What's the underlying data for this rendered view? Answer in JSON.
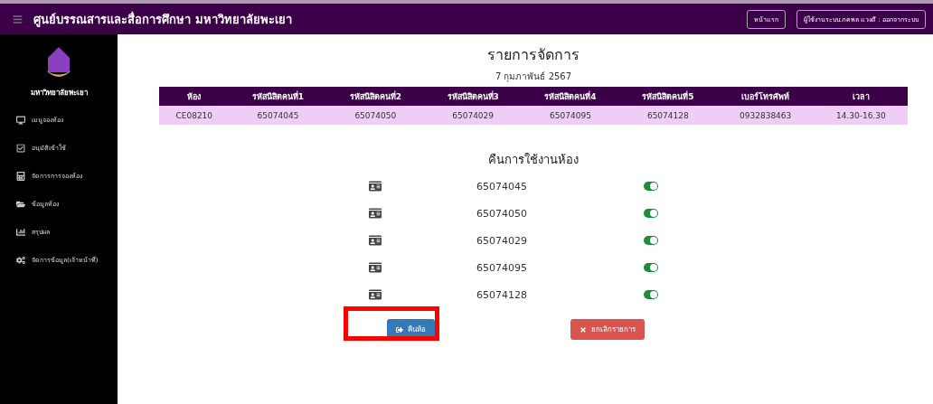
{
  "navbar": {
    "title": "ศูนย์บรรณสารและสื่อการศึกษา มหาวิทยาลัยพะเยา",
    "buttons": [
      "หน้าแรก",
      "ผู้ใช้งานระบบ:ภคพล แวงดี : ออกจากระบบ"
    ]
  },
  "sidebar": {
    "brand": "มหาวิทยาลัยพะเยา",
    "items": [
      {
        "label": "เมนูจองห้อง",
        "kind": "monitor"
      },
      {
        "label": "อนุมัติเข้าใช้",
        "kind": "check"
      },
      {
        "label": "จัดการการจองห้อง",
        "kind": "calc"
      },
      {
        "label": "ข้อมูลห้อง",
        "kind": "folder"
      },
      {
        "label": "สรุปผล",
        "kind": "chart"
      },
      {
        "label": "จัดการข้อมูล(เจ้าหน้าที่)",
        "kind": "gears"
      }
    ]
  },
  "page_title": "รายการจัดการ",
  "date": "7 กุมภาพันธ์ 2567",
  "table": {
    "columns": [
      "ห้อง",
      "รหัสนิสิตคนที่1",
      "รหัสนิสิตคนที่2",
      "รหัสนิสิตคนที่3",
      "รหัสนิสิตคนที่4",
      "รหัสนิสิตคนที่5",
      "เบอร์โทรศัพท์",
      "เวลา"
    ],
    "rows": [
      [
        "CE08210",
        "65074045",
        "65074050",
        "65074029",
        "65074095",
        "65074128",
        "0932838463",
        "14.30-16.30"
      ]
    ]
  },
  "return_section": {
    "title": "คืนการใช้งานห้อง",
    "students": [
      {
        "id": "65074045",
        "on": true
      },
      {
        "id": "65074050",
        "on": true
      },
      {
        "id": "65074029",
        "on": true
      },
      {
        "id": "65074095",
        "on": true
      },
      {
        "id": "65074128",
        "on": true
      }
    ]
  },
  "actions": [
    {
      "label": "คืนห้อ",
      "kind": "return"
    },
    {
      "label": "ยกเลิกรายการ",
      "kind": "cancel"
    }
  ]
}
